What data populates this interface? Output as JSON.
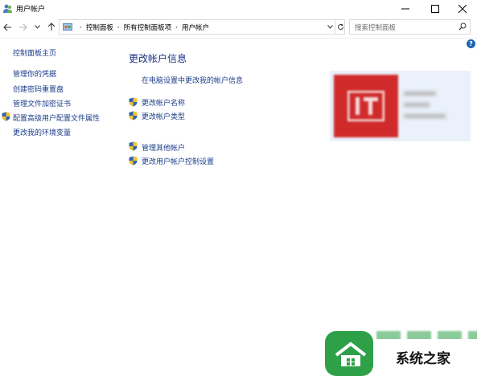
{
  "window": {
    "title": "用户帐户"
  },
  "address": {
    "breadcrumbs": [
      "控制面板",
      "所有控制面板项",
      "用户帐户"
    ]
  },
  "search": {
    "placeholder": "搜索控制面板"
  },
  "help_label": "?",
  "sidebar": {
    "items": [
      {
        "label": "控制面板主页"
      },
      {
        "label": "管理你的凭据"
      },
      {
        "label": "创建密码重置盘"
      },
      {
        "label": "管理文件加密证书"
      },
      {
        "label": "配置高级用户配置文件属性"
      },
      {
        "label": "更改我的环境变量"
      }
    ]
  },
  "main": {
    "heading": "更改帐户信息",
    "pc_settings_link": "在电脑设置中更改我的帐户信息",
    "links": [
      {
        "label": "更改帐户名称"
      },
      {
        "label": "更改帐户类型"
      },
      {
        "label": "管理其他帐户"
      },
      {
        "label": "更改用户帐户控制设置"
      }
    ]
  },
  "watermark": {
    "text": "系统之家"
  },
  "colors": {
    "link": "#1a3c8a",
    "heading": "#1e3287",
    "panel": "#eaf1fa",
    "avatar": "#d02a2a",
    "watermark_green": "#2ea047"
  }
}
